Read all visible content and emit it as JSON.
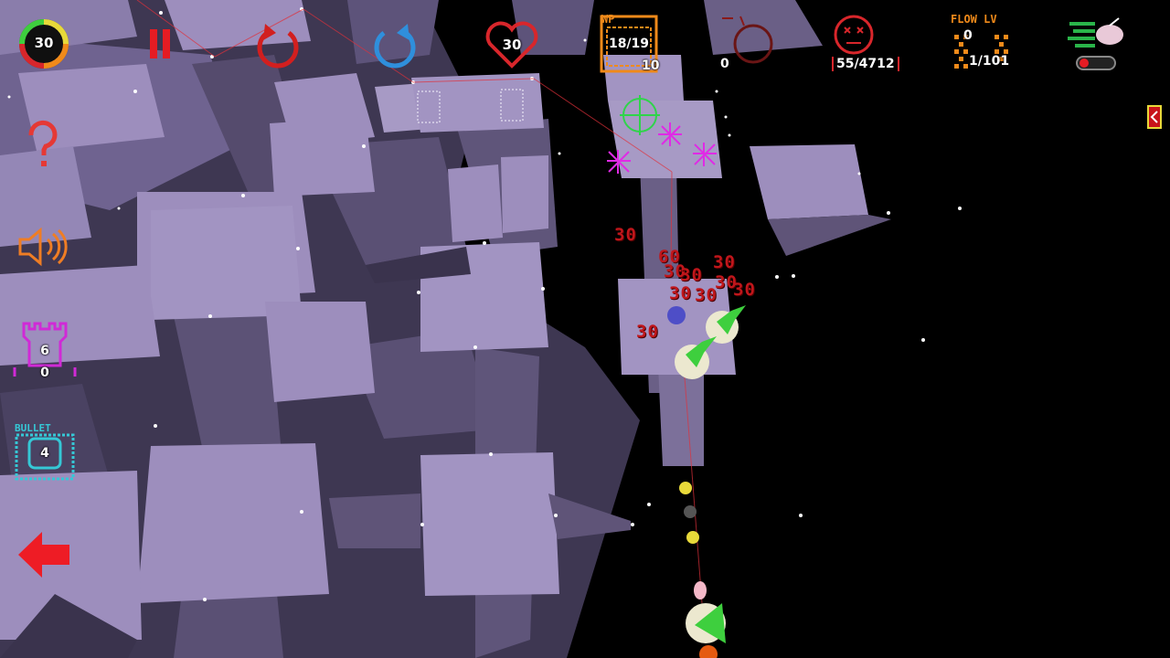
{
  "hud": {
    "life_ring_value": "30",
    "lives_value": "30",
    "wp_label": "WP",
    "wp_progress": "18/19",
    "wp_sub": "10",
    "wave_count": "0",
    "kills": "55/4712",
    "flow_label": "FLOW LV",
    "flow_level": "0",
    "flow_progress": "1/101",
    "tower_count": "6",
    "tower_sub": "0",
    "bullet_label": "BULLET",
    "bullet_count": "4"
  },
  "damage_numbers": [
    "30",
    "60",
    "30",
    "30",
    "30",
    "30",
    "30",
    "30",
    "30",
    "30"
  ],
  "colors": {
    "pause": "#e51c23",
    "restart": "#d21f1f",
    "redo": "#2f8fdc",
    "heart": "#d8262b",
    "wp": "#f08a1a",
    "flow": "#f08a1a",
    "tower": "#d02ad6",
    "bullet": "#35c8d6",
    "sound": "#ef7d24",
    "help": "#e53935",
    "back_arrow": "#ee1c25",
    "block_top": "#9d8ebd",
    "block_side": "#5f5478"
  },
  "icons": {
    "pause": "pause-icon",
    "restart": "restart-icon",
    "redo": "redo-icon",
    "help": "question-mark-icon",
    "sound": "speaker-icon",
    "back": "left-arrow-icon",
    "kills": "skull-face-icon",
    "speed": "fast-forward-icon",
    "side_panel": "side-panel-tab-icon"
  }
}
